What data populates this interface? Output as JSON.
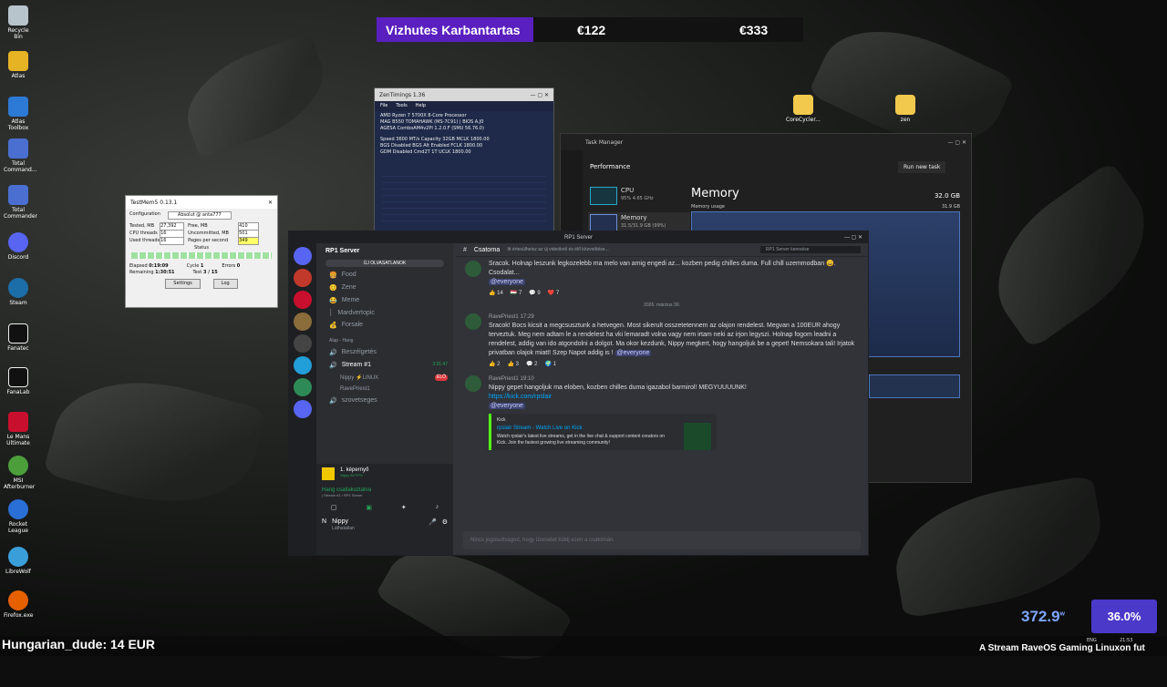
{
  "desktop": {
    "icons": [
      "Recycle Bin",
      "Atlas",
      "Atlas Toolbox",
      "Total Command...",
      "Total Commander",
      "Discord",
      "Steam",
      "Fanatec",
      "FanaLab",
      "Le Mans Ultimate",
      "MSI Afterburner",
      "Rocket League",
      "LibreWolf",
      "Firefox.exe"
    ],
    "folders": [
      "CoreCycler...",
      "zen"
    ]
  },
  "banner": {
    "title": "Vizhutes Karbantartas",
    "amount1": "€122",
    "amount2": "€333"
  },
  "zen": {
    "title": "ZenTimings 1.36",
    "menu": [
      "File",
      "Tools",
      "Help"
    ],
    "cpu": "AMD Ryzen 7 5700X 8-Core Processor",
    "board": "MAG B550 TOMAHAWK (MS-7C91) | BIOS A.J0",
    "agesa": "AGESA ComboAM4v2PI 1.2.0.F (SMU 56.76.0)",
    "row1": "Speed 3600 MT/s  Capacity 32GB  MCLK 1800.00",
    "row2": "BGS Disabled  BGS Alt Enabled  FCLK 1800.00",
    "row3": "GDM Disabled  Cmd2T 1T  UCLK 1800.00"
  },
  "testmem": {
    "title": "TestMem5  0.13.1",
    "config_label": "Configuration",
    "config": "Absolut @ anta777",
    "rows": [
      [
        "Tested, MB",
        "27,392",
        "Free, MB",
        "410"
      ],
      [
        "CPU threads",
        "16",
        "Uncommitted, MB",
        "501"
      ],
      [
        "Used threads",
        "16",
        "Pages per second",
        "349"
      ]
    ],
    "status": "Status",
    "elapsed": "0:19:09",
    "remaining": "1:30:51",
    "cycle": "1",
    "errors": "0",
    "test": "3 / 15",
    "settings": "Settings",
    "log": "Log"
  },
  "taskmgr": {
    "title": "Task Manager",
    "section": "Performance",
    "run": "Run new task",
    "cpu_label": "CPU",
    "cpu_sub": "95% 4.65 GHz",
    "mem_label": "Memory",
    "mem_sub": "31.5/31.9 GB (99%)",
    "heading": "Memory",
    "total": "32.0 GB",
    "usage": "Memory usage",
    "usage_max": "31.9 GB"
  },
  "discord": {
    "title": "RP1 Server",
    "server": "RP1 Server",
    "channel": "Csatorna",
    "topic": "Itt értesülhetsz az új videókról és élő közvetítése...",
    "search": "RP1 Server keresése",
    "unread": "ÚJ OLVASATLANOK",
    "channels": [
      "Food",
      "Zene",
      "Meme",
      "Mardvertopic",
      "Forsale"
    ],
    "voice_cat": "Alap - Hang",
    "voice": [
      "Beszélgetés",
      "Stream #1"
    ],
    "voice_users": [
      "Nippy ⚡LINUX",
      "RavePriest1"
    ],
    "live": "ÉLŐ",
    "timer": "3:31:47",
    "other": "szovetseges",
    "screen": "1. képernyő",
    "screen_sub": "Nippy 60 FPS",
    "connected": "Hang csatlakoztatva",
    "connected_sub": "| Stream #1 / RP1 Server",
    "user": "Nippy",
    "user_status": "Láthatatlan",
    "date": "2026. március 30.",
    "msg0": "Sracok. Holnap leszunk legkozelebb ma melo van amig engedi az... kozben pedig chilles duma. Full chill uzemmodban 😄. Csodalat...",
    "m0_reacts": [
      "👍 14",
      "🇭🇺 7",
      "💬 9",
      "❤️ 7"
    ],
    "msg1_author": "RavePriest1",
    "msg1_time": "17:29",
    "msg1": "Sracok! Bocs kicsit a megcsusztunk a hetvegen. Most sikerult osszetetennem az olajon rendelest. Megvan a 100EUR ahogy terveztuk. Meg nem adtam le a rendelest ha vki lemaradt volna vagy nem irtam neki az irjon legyszi. Holnap fogom leadni a rendelest, addig van ido atgondolni a dolgot. Ma okor kezdunk, Nippy megkert, hogy hangoljuk be a gepet! Nemsokara tali! Irjatok privatban olajok miatt! Szep Napot addig is !",
    "m1_reacts": [
      "👍 2",
      "👍 3",
      "💬 2",
      "🌍 1"
    ],
    "msg2_author": "RavePriest1",
    "msg2_time": "19:10",
    "msg2": "Nippy gepet hangoljuk ma eloben, kozben chilles duma igazabol barmirol! MEGYUUUUNK!",
    "link": "https://kick.com/rpslair",
    "everyone": "@everyone",
    "embed_site": "Kick",
    "embed_title": "rpslair Stream - Watch Live on Kick",
    "embed_desc": "Watch rpslair's latest live streams, get in the live chat & support content creators on Kick. Join the fastest growing live streaming community!",
    "input": "Nincs jogosultságod, hogy üzenetet küldj ezen a csatornán."
  },
  "overlay": {
    "watts": "372.9",
    "watt_unit": "w",
    "percent": "36.0%",
    "ticker_left": "Hungarian_dude: 14 EUR",
    "ticker_right": "A Stream RaveOS Gaming Linuxon fut",
    "lang": "ENG",
    "time": "21:53"
  }
}
